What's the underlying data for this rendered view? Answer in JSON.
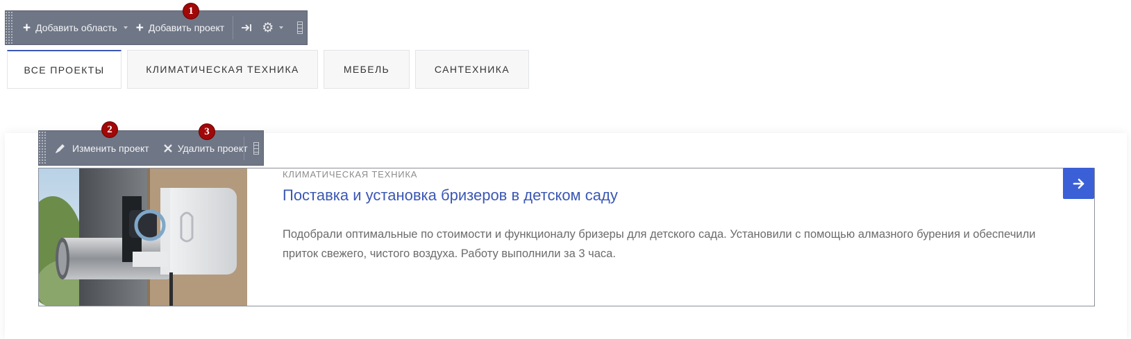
{
  "admin_toolbar": {
    "add_area_label": "Добавить область",
    "add_project_label": "Добавить проект"
  },
  "tabs": [
    {
      "label": "ВСЕ ПРОЕКТЫ",
      "active": true
    },
    {
      "label": "КЛИМАТИЧЕСКАЯ ТЕХНИКА",
      "active": false
    },
    {
      "label": "МЕБЕЛЬ",
      "active": false
    },
    {
      "label": "САНТЕХНИКА",
      "active": false
    }
  ],
  "project_toolbar": {
    "edit_label": "Изменить проект",
    "delete_label": "Удалить проект"
  },
  "badges": [
    "1",
    "2",
    "3"
  ],
  "project": {
    "category": "КЛИМАТИЧЕСКАЯ ТЕХНИКА",
    "title": "Поставка и установка бризеров в детском саду",
    "description": "Подобрали оптимальные по стоимости и функционалу бризеры для детского сада. Установили с помощью алмазного бурения и обеспечили приток свежего, чистого воздуха. Работу выполнили за 3 часа."
  },
  "colors": {
    "accent": "#3b57b4",
    "button": "#3b5fd6",
    "toolbar": "#6f7686",
    "badge": "#a10808"
  }
}
